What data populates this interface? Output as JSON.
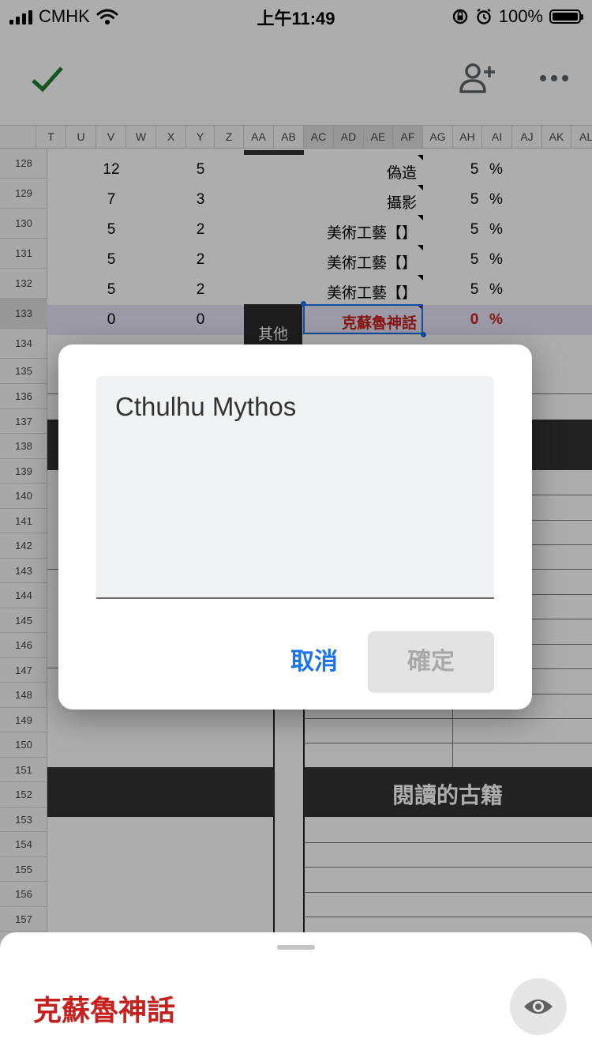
{
  "status_bar": {
    "carrier": "CMHK",
    "time": "上午11:49",
    "battery": "100%",
    "battery_level": 1.0
  },
  "app_bar": {
    "confirm_icon": "check-icon",
    "share_icon": "person-add-icon",
    "more_icon": "more-horiz-icon"
  },
  "sheet": {
    "columns": [
      "T",
      "U",
      "V",
      "W",
      "X",
      "Y",
      "Z",
      "AA",
      "AB",
      "AC",
      "AD",
      "AE",
      "AF",
      "AG",
      "AH",
      "AI",
      "AJ",
      "AK",
      "AL"
    ],
    "rows": [
      "128",
      "129",
      "130",
      "131",
      "132",
      "133",
      "134",
      "135",
      "136",
      "137",
      "138",
      "139",
      "140",
      "141",
      "142",
      "143",
      "144",
      "145",
      "146",
      "147",
      "148",
      "149",
      "150",
      "151",
      "152",
      "153",
      "154",
      "155",
      "156",
      "157"
    ],
    "data_rows": [
      {
        "v": "12",
        "y": "5",
        "skill": "偽造",
        "ah": "5",
        "pct": "%"
      },
      {
        "v": "7",
        "y": "3",
        "skill": "攝影",
        "ah": "5",
        "pct": "%"
      },
      {
        "v": "5",
        "y": "2",
        "skill": "美術工藝【】",
        "ah": "5",
        "pct": "%"
      },
      {
        "v": "5",
        "y": "2",
        "skill": "美術工藝【】",
        "ah": "5",
        "pct": "%"
      },
      {
        "v": "5",
        "y": "2",
        "skill": "美術工藝【】",
        "ah": "5",
        "pct": "%"
      },
      {
        "v": "0",
        "y": "0",
        "skill": "克蘇魯神話",
        "ah": "0",
        "pct": "%"
      }
    ],
    "other_label": "其他",
    "ancient_books_header": "閱讀的古籍",
    "highlight_color": "#c5221f"
  },
  "dialog": {
    "input_value": "Cthulhu Mythos",
    "cancel_label": "取消",
    "ok_label": "確定"
  },
  "bottom_sheet": {
    "cell_value": "克蘇魯神話",
    "view_icon": "eye-icon"
  }
}
